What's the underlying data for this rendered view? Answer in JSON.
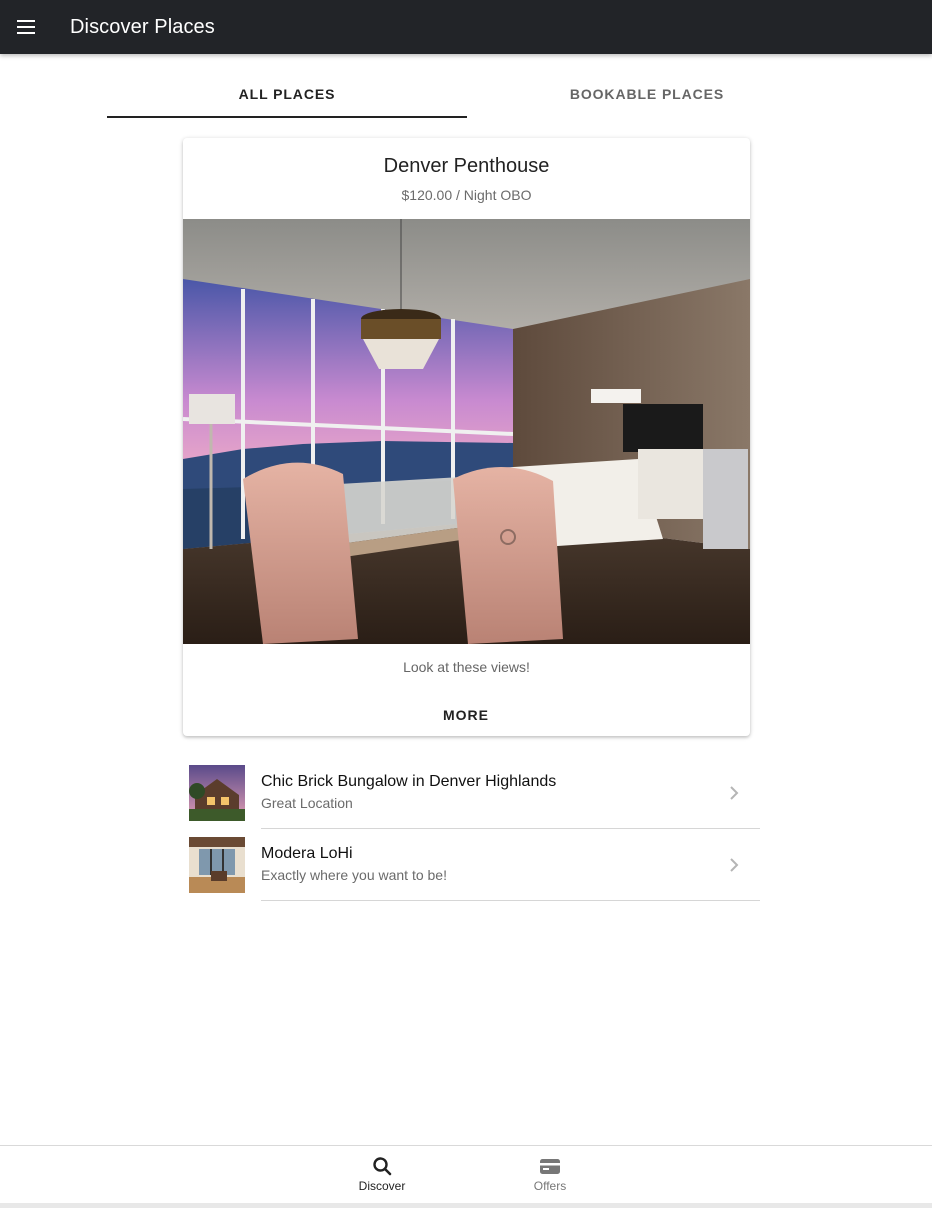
{
  "toolbar": {
    "title": "Discover Places",
    "menu_icon": "menu-icon",
    "background": "#222428"
  },
  "segment": {
    "tabs": [
      {
        "label": "ALL PLACES",
        "active": true
      },
      {
        "label": "BOOKABLE PLACES",
        "active": false
      }
    ]
  },
  "featured": {
    "title": "Denver Penthouse",
    "subtitle": "$120.00 / Night OBO",
    "description": "Look at these views!",
    "more_label": "MORE"
  },
  "places": [
    {
      "title": "Chic Brick Bungalow in Denver Highlands",
      "subtitle": "Great Location",
      "icon": "chevron-forward-icon"
    },
    {
      "title": "Modera LoHi",
      "subtitle": "Exactly where you want to be!",
      "icon": "chevron-forward-icon"
    }
  ],
  "tabbar": {
    "tabs": [
      {
        "label": "Discover",
        "icon": "search-icon",
        "active": true
      },
      {
        "label": "Offers",
        "icon": "card-icon",
        "active": false
      }
    ]
  }
}
